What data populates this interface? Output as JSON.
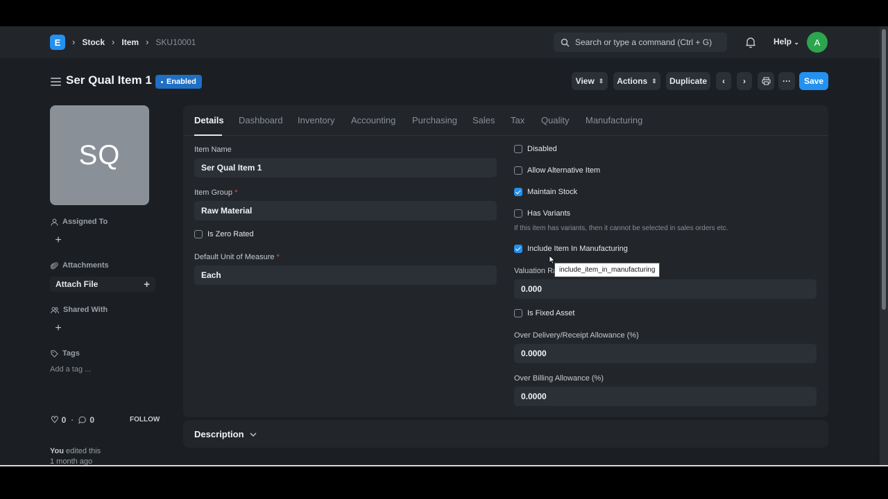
{
  "navbar": {
    "logo_letter": "E",
    "breadcrumbs": [
      "Stock",
      "Item",
      "SKU10001"
    ],
    "search_placeholder": "Search or type a command (Ctrl + G)",
    "help_label": "Help",
    "avatar_initial": "A"
  },
  "page": {
    "title": "Ser Qual Item 1",
    "status": "Enabled",
    "buttons": {
      "view": "View",
      "actions": "Actions",
      "duplicate": "Duplicate",
      "save": "Save"
    }
  },
  "sidebar": {
    "image_initials": "SQ",
    "assigned_to": "Assigned To",
    "attachments": "Attachments",
    "attach_file": "Attach File",
    "shared_with": "Shared With",
    "tags": "Tags",
    "add_tag": "Add a tag ...",
    "likes": "0",
    "comments": "0",
    "follow": "FOLLOW",
    "edited_by": "You",
    "edited_text": "edited this",
    "edited_time": "1 month ago"
  },
  "tabs": [
    "Details",
    "Dashboard",
    "Inventory",
    "Accounting",
    "Purchasing",
    "Sales",
    "Tax",
    "Quality",
    "Manufacturing"
  ],
  "form": {
    "item_name_label": "Item Name",
    "item_name": "Ser Qual Item 1",
    "item_group_label": "Item Group",
    "item_group": "Raw Material",
    "is_zero_rated": "Is Zero Rated",
    "uom_label": "Default Unit of Measure",
    "uom": "Each",
    "disabled": "Disabled",
    "allow_alternative": "Allow Alternative Item",
    "maintain_stock": "Maintain Stock",
    "has_variants": "Has Variants",
    "variants_help": "If this item has variants, then it cannot be selected in sales orders etc.",
    "include_manufacturing": "Include Item In Manufacturing",
    "valuation_label": "Valuation Ra",
    "valuation_value": "0.000",
    "tooltip": "include_item_in_manufacturing",
    "is_fixed_asset": "Is Fixed Asset",
    "over_delivery_label": "Over Delivery/Receipt Allowance (%)",
    "over_delivery_value": "0.0000",
    "over_billing_label": "Over Billing Allowance (%)",
    "over_billing_value": "0.0000"
  },
  "sections": {
    "description": "Description"
  },
  "colors": {
    "accent": "#2490ef",
    "avatar": "#2da44e",
    "background": "#1b1f23"
  }
}
